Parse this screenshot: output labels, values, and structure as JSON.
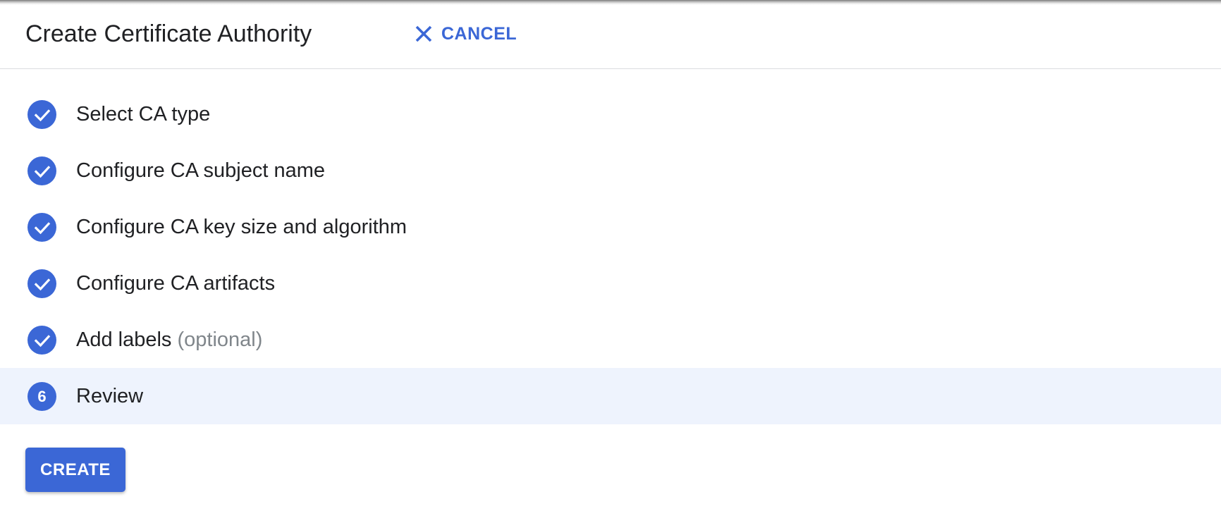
{
  "header": {
    "title": "Create Certificate Authority",
    "cancel_label": "CANCEL",
    "cancel_icon": "close-icon"
  },
  "steps": [
    {
      "label": "Select CA type",
      "suffix": "",
      "status": "complete",
      "icon": "check-icon"
    },
    {
      "label": "Configure CA subject name",
      "suffix": "",
      "status": "complete",
      "icon": "check-icon"
    },
    {
      "label": "Configure CA key size and algorithm",
      "suffix": "",
      "status": "complete",
      "icon": "check-icon"
    },
    {
      "label": "Configure CA artifacts",
      "suffix": "",
      "status": "complete",
      "icon": "check-icon"
    },
    {
      "label": "Add labels",
      "suffix": "(optional)",
      "status": "complete",
      "icon": "check-icon"
    },
    {
      "label": "Review",
      "suffix": "",
      "status": "current",
      "number": "6"
    }
  ],
  "actions": {
    "create_label": "CREATE"
  },
  "colors": {
    "accent": "#3b67d6",
    "active_row_bg": "#eef3fd",
    "optional_text": "#80868b",
    "divider": "#dadce0"
  }
}
